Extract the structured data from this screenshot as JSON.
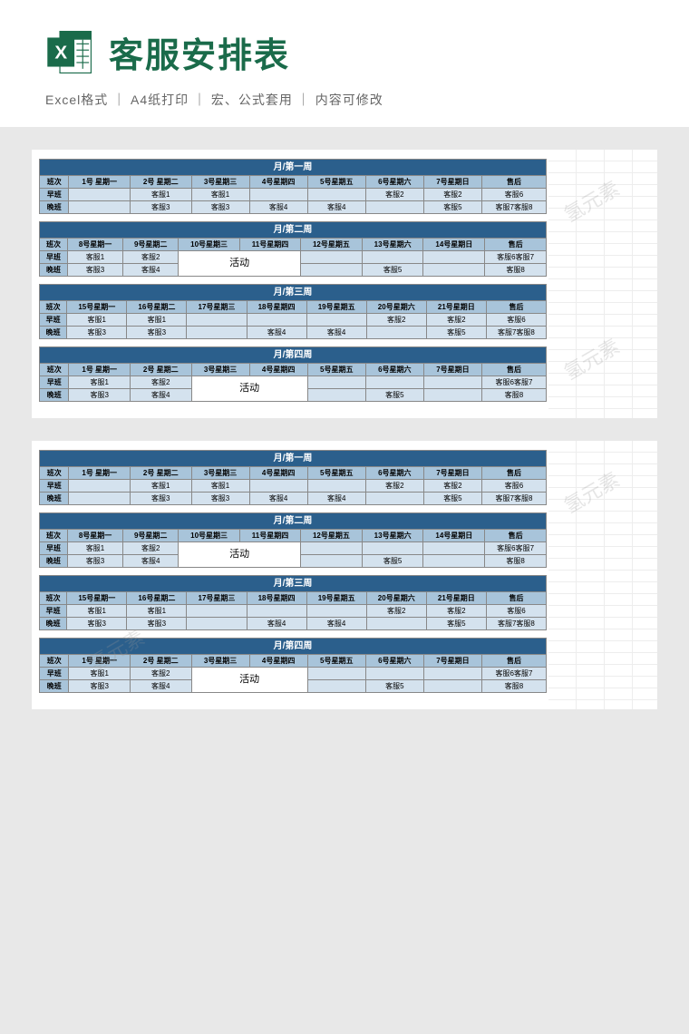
{
  "header": {
    "title": "客服安排表",
    "subtitle": "Excel格式 ｜ A4纸打印 ｜ 宏、公式套用 ｜ 内容可修改",
    "icon_label": "X"
  },
  "watermark": "氢元素",
  "labels": {
    "shift_col": "班次",
    "morning": "早班",
    "evening": "晚班",
    "after": "售后",
    "activity": "活动"
  },
  "weeks": [
    {
      "title": "月/第一周",
      "days": [
        "1号  星期一",
        "2号  星期二",
        "3号星期三",
        "4号星期四",
        "5号星期五",
        "6号星期六",
        "7号星期日"
      ],
      "morning": [
        "",
        "客服1",
        "客服1",
        "",
        "",
        "客服2",
        "客服2"
      ],
      "evening": [
        "",
        "客服3",
        "客服3",
        "客服4",
        "客服4",
        "",
        "客服5"
      ],
      "after_m": "客服6",
      "after_e": "客服7客服8"
    },
    {
      "title": "月/第二周",
      "days": [
        "8号星期一",
        "9号星期二",
        "10号星期三",
        "11号星期四",
        "12号星期五",
        "13号星期六",
        "14号星期日"
      ],
      "morning": [
        "客服1",
        "客服2",
        "",
        "",
        "",
        "",
        ""
      ],
      "evening": [
        "客服3",
        "客服4",
        "",
        "",
        "",
        "客服5",
        ""
      ],
      "after_m": "客服6客服7",
      "after_e": "客服8",
      "activity": true
    },
    {
      "title": "月/第三周",
      "days": [
        "15号星期一",
        "16号星期二",
        "17号星期三",
        "18号星期四",
        "19号星期五",
        "20号星期六",
        "21号星期日"
      ],
      "morning": [
        "客服1",
        "客服1",
        "",
        "",
        "",
        "客服2",
        "客服2"
      ],
      "evening": [
        "客服3",
        "客服3",
        "",
        "客服4",
        "客服4",
        "",
        "客服5"
      ],
      "after_m": "客服6",
      "after_e": "客服7客服8"
    },
    {
      "title": "月/第四周",
      "days": [
        "1号  星期一",
        "2号  星期二",
        "3号星期三",
        "4号星期四",
        "5号星期五",
        "6号星期六",
        "7号星期日"
      ],
      "morning": [
        "客服1",
        "客服2",
        "",
        "",
        "",
        "",
        ""
      ],
      "evening": [
        "客服3",
        "客服4",
        "",
        "",
        "",
        "客服5",
        ""
      ],
      "after_m": "客服6客服7",
      "after_e": "客服8",
      "activity": true
    }
  ]
}
